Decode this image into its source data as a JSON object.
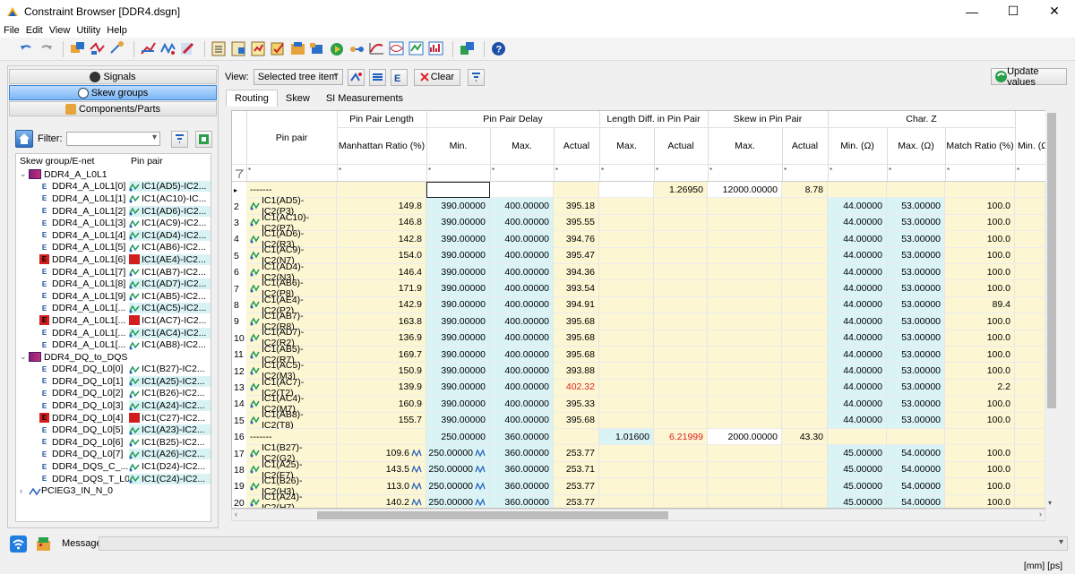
{
  "window": {
    "title": "Constraint Browser [DDR4.dsgn]",
    "minimize": "—",
    "maximize": "☐",
    "close": "✕"
  },
  "menu": [
    "File",
    "Edit",
    "View",
    "Utility",
    "Help"
  ],
  "left": {
    "buttons": [
      "Signals",
      "Skew groups",
      "Components/Parts"
    ],
    "filter_label": "Filter:",
    "filter_value": "",
    "tree_headers": [
      "Skew group/E-net",
      "Pin pair"
    ],
    "tree": [
      {
        "label": "DDR4_A_L0L1",
        "pin": "",
        "type": "group",
        "indent": 0,
        "expanded": true,
        "selected": true
      },
      {
        "label": "DDR4_A_L0L1[0]",
        "pin": "IC1(AD5)-IC2...",
        "type": "enet",
        "indent": 1,
        "cyan": true
      },
      {
        "label": "DDR4_A_L0L1[1]",
        "pin": "IC1(AC10)-IC...",
        "type": "enet",
        "indent": 1
      },
      {
        "label": "DDR4_A_L0L1[2]",
        "pin": "IC1(AD6)-IC2...",
        "type": "enet",
        "indent": 1,
        "cyan": true
      },
      {
        "label": "DDR4_A_L0L1[3]",
        "pin": "IC1(AC9)-IC2...",
        "type": "enet",
        "indent": 1
      },
      {
        "label": "DDR4_A_L0L1[4]",
        "pin": "IC1(AD4)-IC2...",
        "type": "enet",
        "indent": 1,
        "cyan": true
      },
      {
        "label": "DDR4_A_L0L1[5]",
        "pin": "IC1(AB6)-IC2...",
        "type": "enet",
        "indent": 1
      },
      {
        "label": "DDR4_A_L0L1[6]",
        "pin": "IC1(AE4)-IC2...",
        "type": "enet",
        "indent": 1,
        "red": true,
        "cyan": true
      },
      {
        "label": "DDR4_A_L0L1[7]",
        "pin": "IC1(AB7)-IC2...",
        "type": "enet",
        "indent": 1
      },
      {
        "label": "DDR4_A_L0L1[8]",
        "pin": "IC1(AD7)-IC2...",
        "type": "enet",
        "indent": 1,
        "cyan": true
      },
      {
        "label": "DDR4_A_L0L1[9]",
        "pin": "IC1(AB5)-IC2...",
        "type": "enet",
        "indent": 1
      },
      {
        "label": "DDR4_A_L0L1[...",
        "pin": "IC1(AC5)-IC2...",
        "type": "enet",
        "indent": 1,
        "cyan": true
      },
      {
        "label": "DDR4_A_L0L1[...",
        "pin": "IC1(AC7)-IC2...",
        "type": "enet",
        "indent": 1,
        "red": true
      },
      {
        "label": "DDR4_A_L0L1[...",
        "pin": "IC1(AC4)-IC2...",
        "type": "enet",
        "indent": 1,
        "cyan": true
      },
      {
        "label": "DDR4_A_L0L1[...",
        "pin": "IC1(AB8)-IC2...",
        "type": "enet",
        "indent": 1
      },
      {
        "label": "DDR4_DQ_to_DQS",
        "pin": "",
        "type": "group",
        "indent": 0,
        "expanded": true,
        "selected": true
      },
      {
        "label": "DDR4_DQ_L0[0]",
        "pin": "IC1(B27)-IC2...",
        "type": "enet",
        "indent": 1
      },
      {
        "label": "DDR4_DQ_L0[1]",
        "pin": "IC1(A25)-IC2...",
        "type": "enet",
        "indent": 1,
        "cyan": true
      },
      {
        "label": "DDR4_DQ_L0[2]",
        "pin": "IC1(B26)-IC2...",
        "type": "enet",
        "indent": 1
      },
      {
        "label": "DDR4_DQ_L0[3]",
        "pin": "IC1(A24)-IC2...",
        "type": "enet",
        "indent": 1,
        "cyan": true
      },
      {
        "label": "DDR4_DQ_L0[4]",
        "pin": "IC1(C27)-IC2...",
        "type": "enet",
        "indent": 1,
        "red": true
      },
      {
        "label": "DDR4_DQ_L0[5]",
        "pin": "IC1(A23)-IC2...",
        "type": "enet",
        "indent": 1,
        "cyan": true
      },
      {
        "label": "DDR4_DQ_L0[6]",
        "pin": "IC1(B25)-IC2...",
        "type": "enet",
        "indent": 1
      },
      {
        "label": "DDR4_DQ_L0[7]",
        "pin": "IC1(A26)-IC2...",
        "type": "enet",
        "indent": 1,
        "cyan": true
      },
      {
        "label": "DDR4_DQS_C_...",
        "pin": "IC1(D24)-IC2...",
        "type": "enet",
        "indent": 1
      },
      {
        "label": "DDR4_DQS_T_L0",
        "pin": "IC1(C24)-IC2...",
        "type": "enet",
        "indent": 1,
        "cyan": true
      },
      {
        "label": "PCIEG3_IN_N_0",
        "pin": "",
        "type": "signal",
        "indent": 0,
        "expanded": false
      }
    ]
  },
  "view": {
    "label": "View:",
    "value": "Selected tree item",
    "clear": "Clear",
    "update": "Update values"
  },
  "tabs": [
    "Routing",
    "Skew",
    "SI Measurements"
  ],
  "grid": {
    "headers": {
      "pin_pair": "Pin pair",
      "ppl": "Pin Pair Length",
      "ppl_sub": "Manhattan Ratio (%)",
      "ppd": "Pin Pair Delay",
      "min": "Min.",
      "max": "Max.",
      "actual": "Actual",
      "ld": "Length Diff. in Pin Pair",
      "skew": "Skew in Pin Pair",
      "charz": "Char. Z",
      "minohm": "Min. (Ω)",
      "maxohm": "Max. (Ω)",
      "match": "Match Ratio (%)",
      "min2": "Min. (Ω",
      "filter_mark": "*"
    },
    "rows": [
      {
        "n": "▸",
        "pin": "-------",
        "ratio": "",
        "dmin": "",
        "dmax": "",
        "dact": "",
        "ldmax": "",
        "ldact": "1.26950",
        "skmax": "12000.00000",
        "skact": "8.78",
        "zmin": "",
        "zmax": "",
        "match": "",
        "group": true,
        "edit": true
      },
      {
        "n": "2",
        "pin": "IC1(AD5)-IC2(P3)",
        "ratio": "149.8",
        "dmin": "390.00000",
        "dmax": "400.00000",
        "dact": "395.18",
        "zmin": "44.00000",
        "zmax": "53.00000",
        "match": "100.0"
      },
      {
        "n": "3",
        "pin": "IC1(AC10)-IC2(P7)",
        "ratio": "146.8",
        "dmin": "390.00000",
        "dmax": "400.00000",
        "dact": "395.55",
        "zmin": "44.00000",
        "zmax": "53.00000",
        "match": "100.0"
      },
      {
        "n": "4",
        "pin": "IC1(AD6)-IC2(R3)",
        "ratio": "142.8",
        "dmin": "390.00000",
        "dmax": "400.00000",
        "dact": "394.76",
        "zmin": "44.00000",
        "zmax": "53.00000",
        "match": "100.0"
      },
      {
        "n": "5",
        "pin": "IC1(AC9)-IC2(N7)",
        "ratio": "154.0",
        "dmin": "390.00000",
        "dmax": "400.00000",
        "dact": "395.47",
        "zmin": "44.00000",
        "zmax": "53.00000",
        "match": "100.0"
      },
      {
        "n": "6",
        "pin": "IC1(AD4)-IC2(N3)",
        "ratio": "146.4",
        "dmin": "390.00000",
        "dmax": "400.00000",
        "dact": "394.36",
        "zmin": "44.00000",
        "zmax": "53.00000",
        "match": "100.0"
      },
      {
        "n": "7",
        "pin": "IC1(AB6)-IC2(P8)",
        "ratio": "171.9",
        "dmin": "390.00000",
        "dmax": "400.00000",
        "dact": "393.54",
        "zmin": "44.00000",
        "zmax": "53.00000",
        "match": "100.0"
      },
      {
        "n": "8",
        "pin": "IC1(AE4)-IC2(P2)",
        "ratio": "142.9",
        "dmin": "390.00000",
        "dmax": "400.00000",
        "dact": "394.91",
        "zmin": "44.00000",
        "zmax": "53.00000",
        "match": "89.4"
      },
      {
        "n": "9",
        "pin": "IC1(AB7)-IC2(R8)",
        "ratio": "163.8",
        "dmin": "390.00000",
        "dmax": "400.00000",
        "dact": "395.68",
        "zmin": "44.00000",
        "zmax": "53.00000",
        "match": "100.0"
      },
      {
        "n": "10",
        "pin": "IC1(AD7)-IC2(R2)",
        "ratio": "136.9",
        "dmin": "390.00000",
        "dmax": "400.00000",
        "dact": "395.68",
        "zmin": "44.00000",
        "zmax": "53.00000",
        "match": "100.0"
      },
      {
        "n": "11",
        "pin": "IC1(AB5)-IC2(R7)",
        "ratio": "169.7",
        "dmin": "390.00000",
        "dmax": "400.00000",
        "dact": "395.68",
        "zmin": "44.00000",
        "zmax": "53.00000",
        "match": "100.0"
      },
      {
        "n": "12",
        "pin": "IC1(AC5)-IC2(M3)",
        "ratio": "150.9",
        "dmin": "390.00000",
        "dmax": "400.00000",
        "dact": "393.88",
        "zmin": "44.00000",
        "zmax": "53.00000",
        "match": "100.0"
      },
      {
        "n": "13",
        "pin": "IC1(AC7)-IC2(T2)",
        "ratio": "139.9",
        "dmin": "390.00000",
        "dmax": "400.00000",
        "dact": "402.32",
        "dact_red": true,
        "zmin": "44.00000",
        "zmax": "53.00000",
        "match": "2.2"
      },
      {
        "n": "14",
        "pin": "IC1(AC4)-IC2(M7)",
        "ratio": "160.9",
        "dmin": "390.00000",
        "dmax": "400.00000",
        "dact": "395.33",
        "zmin": "44.00000",
        "zmax": "53.00000",
        "match": "100.0"
      },
      {
        "n": "15",
        "pin": "IC1(AB8)-IC2(T8)",
        "ratio": "155.7",
        "dmin": "390.00000",
        "dmax": "400.00000",
        "dact": "395.68",
        "zmin": "44.00000",
        "zmax": "53.00000",
        "match": "100.0"
      },
      {
        "n": "16",
        "pin": "-------",
        "ratio": "",
        "dmin": "250.00000",
        "dmax": "360.00000",
        "dact": "",
        "ldmax": "1.01600",
        "ldact": "6.21999",
        "ldact_red": true,
        "skmax": "2000.00000",
        "skact": "43.30",
        "zmin": "",
        "zmax": "",
        "match": "",
        "group": true
      },
      {
        "n": "17",
        "pin": "IC1(B27)-IC2(G2)",
        "ratio": "109.6",
        "dmin": "250.00000",
        "dmax": "360.00000",
        "dact": "253.77",
        "zmin": "45.00000",
        "zmax": "54.00000",
        "match": "100.0",
        "lenicon": true
      },
      {
        "n": "18",
        "pin": "IC1(A25)-IC2(F7)",
        "ratio": "143.5",
        "dmin": "250.00000",
        "dmax": "360.00000",
        "dact": "253.71",
        "zmin": "45.00000",
        "zmax": "54.00000",
        "match": "100.0",
        "lenicon": true
      },
      {
        "n": "19",
        "pin": "IC1(B26)-IC2(H3)",
        "ratio": "113.0",
        "dmin": "250.00000",
        "dmax": "360.00000",
        "dact": "253.77",
        "zmin": "45.00000",
        "zmax": "54.00000",
        "match": "100.0",
        "lenicon": true
      },
      {
        "n": "20",
        "pin": "IC1(A24)-IC2(H7)",
        "ratio": "140.2",
        "dmin": "250.00000",
        "dmax": "360.00000",
        "dact": "253.77",
        "zmin": "45.00000",
        "zmax": "54.00000",
        "match": "100.0",
        "lenicon": true
      }
    ]
  },
  "status": {
    "message_label": "Message:",
    "units": "[mm]  [ps]"
  },
  "colors": {
    "yellow_cell": "#fcf6d2",
    "cyan_cell": "#daf3f5",
    "violation": "#dd2222",
    "selection": "#1f7de0"
  }
}
